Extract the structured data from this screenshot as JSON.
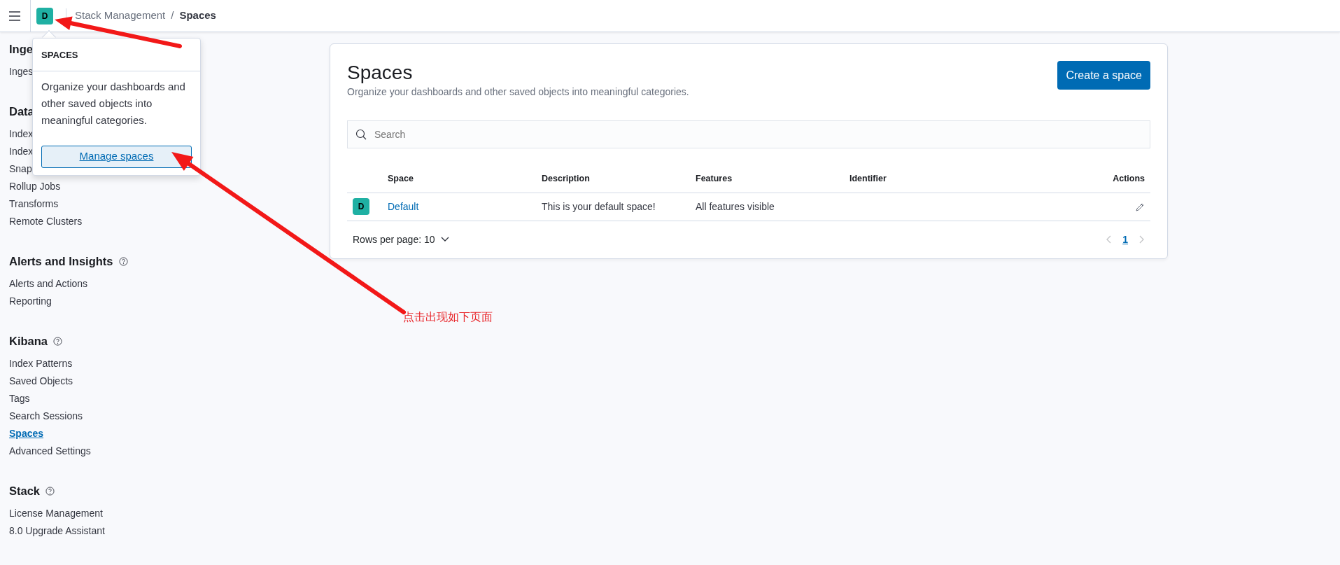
{
  "header": {
    "space_avatar": {
      "initial": "D",
      "color": "#1fb0a3"
    },
    "breadcrumb_separator": "/",
    "breadcrumbs": [
      {
        "label": "Stack Management",
        "selected": false
      },
      {
        "label": "Spaces",
        "selected": true
      }
    ]
  },
  "sidebar": {
    "sections": [
      {
        "title": "Inge",
        "items": [
          {
            "label": "Inges",
            "selected": false
          }
        ]
      },
      {
        "title": "Data",
        "items": [
          {
            "label": "Index",
            "selected": false
          },
          {
            "label": "Index",
            "selected": false
          },
          {
            "label": "Snap",
            "selected": false
          },
          {
            "label": "Rollup Jobs",
            "selected": false
          },
          {
            "label": "Transforms",
            "selected": false
          },
          {
            "label": "Remote Clusters",
            "selected": false
          }
        ]
      },
      {
        "title": "Alerts and Insights",
        "help_icon": true,
        "items": [
          {
            "label": "Alerts and Actions",
            "selected": false
          },
          {
            "label": "Reporting",
            "selected": false
          }
        ]
      },
      {
        "title": "Kibana",
        "help_icon": true,
        "items": [
          {
            "label": "Index Patterns",
            "selected": false
          },
          {
            "label": "Saved Objects",
            "selected": false
          },
          {
            "label": "Tags",
            "selected": false
          },
          {
            "label": "Search Sessions",
            "selected": false
          },
          {
            "label": "Spaces",
            "selected": true
          },
          {
            "label": "Advanced Settings",
            "selected": false
          }
        ]
      },
      {
        "title": "Stack",
        "help_icon": true,
        "items": [
          {
            "label": "License Management",
            "selected": false
          },
          {
            "label": "8.0 Upgrade Assistant",
            "selected": false
          }
        ]
      }
    ]
  },
  "popover": {
    "title": "SPACES",
    "text": "Organize your dashboards and other saved objects into meaningful categories.",
    "button": "Manage spaces"
  },
  "page": {
    "title": "Spaces",
    "description": "Organize your dashboards and other saved objects into meaningful categories.",
    "create_button": "Create a space",
    "search": {
      "placeholder": "Search"
    },
    "table": {
      "columns": [
        "Space",
        "Description",
        "Features",
        "Identifier",
        "Actions"
      ],
      "rows": [
        {
          "initial": "D",
          "color": "#1fb0a3",
          "space": "Default",
          "description": "This is your default space!",
          "features": "All features visible"
        }
      ]
    },
    "rows_per_page": "Rows per page: 10",
    "pages": [
      {
        "label": "1",
        "selected": true
      }
    ]
  },
  "annotation": {
    "text": "点击出现如下页面"
  }
}
